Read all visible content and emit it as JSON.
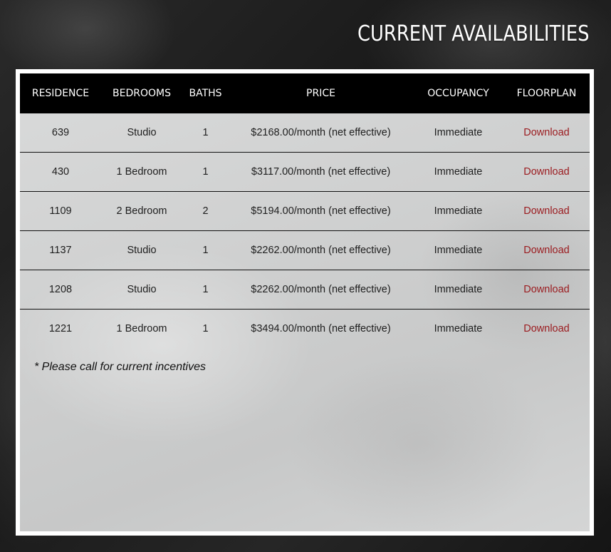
{
  "page_title": "CURRENT AVAILABILITIES",
  "table": {
    "headers": {
      "residence": "RESIDENCE",
      "bedrooms": "BEDROOMS",
      "baths": "BATHS",
      "price": "PRICE",
      "occupancy": "OCCUPANCY",
      "floorplan": "FLOORPLAN"
    },
    "rows": [
      {
        "residence": "639",
        "bedrooms": "Studio",
        "baths": "1",
        "price": "$2168.00/month (net effective)",
        "occupancy": "Immediate",
        "floorplan": "Download"
      },
      {
        "residence": "430",
        "bedrooms": "1 Bedroom",
        "baths": "1",
        "price": "$3117.00/month (net effective)",
        "occupancy": "Immediate",
        "floorplan": "Download"
      },
      {
        "residence": "1109",
        "bedrooms": "2 Bedroom",
        "baths": "2",
        "price": "$5194.00/month (net effective)",
        "occupancy": "Immediate",
        "floorplan": "Download"
      },
      {
        "residence": "1137",
        "bedrooms": "Studio",
        "baths": "1",
        "price": "$2262.00/month (net effective)",
        "occupancy": "Immediate",
        "floorplan": "Download"
      },
      {
        "residence": "1208",
        "bedrooms": "Studio",
        "baths": "1",
        "price": "$2262.00/month (net effective)",
        "occupancy": "Immediate",
        "floorplan": "Download"
      },
      {
        "residence": "1221",
        "bedrooms": "1 Bedroom",
        "baths": "1",
        "price": "$3494.00/month (net effective)",
        "occupancy": "Immediate",
        "floorplan": "Download"
      }
    ]
  },
  "note": "* Please call for current incentives",
  "colors": {
    "link": "#9b1b1f",
    "header_bg": "#000000",
    "page_bg": "#1e1e1e"
  }
}
